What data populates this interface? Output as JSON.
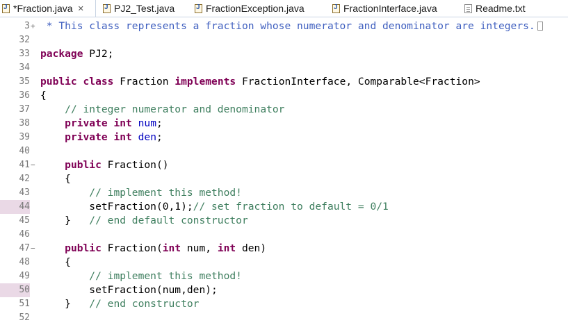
{
  "tabs": [
    {
      "label": "*Fraction.java",
      "icon": "java-file-icon",
      "active": true,
      "close": "✕"
    },
    {
      "label": "PJ2_Test.java",
      "icon": "java-file-icon"
    },
    {
      "label": "FractionException.java",
      "icon": "java-file-icon"
    },
    {
      "label": "FractionInterface.java",
      "icon": "java-file-icon"
    },
    {
      "label": "Readme.txt",
      "icon": "text-file-icon"
    }
  ],
  "editor": {
    "highlighted_lines": [
      "44",
      "50"
    ],
    "lines": [
      {
        "n": "3",
        "fold": "+",
        "t": [
          {
            "s": " * This class represents a fraction whose numerator and denominator are integers.",
            "c": "jd"
          }
        ],
        "collapsed": true
      },
      {
        "n": "32",
        "t": []
      },
      {
        "n": "33",
        "t": [
          {
            "s": "package",
            "c": "kw"
          },
          {
            "s": " PJ2;"
          }
        ]
      },
      {
        "n": "34",
        "t": []
      },
      {
        "n": "35",
        "t": [
          {
            "s": "public",
            "c": "kw"
          },
          {
            "s": " "
          },
          {
            "s": "class",
            "c": "kw"
          },
          {
            "s": " Fraction "
          },
          {
            "s": "implements",
            "c": "kw"
          },
          {
            "s": " FractionInterface, Comparable<Fraction>"
          }
        ]
      },
      {
        "n": "36",
        "t": [
          {
            "s": "{"
          }
        ]
      },
      {
        "n": "37",
        "t": [
          {
            "s": "    "
          },
          {
            "s": "// integer numerator and denominator",
            "c": "cm"
          }
        ]
      },
      {
        "n": "38",
        "t": [
          {
            "s": "    "
          },
          {
            "s": "private",
            "c": "kw"
          },
          {
            "s": " "
          },
          {
            "s": "int",
            "c": "kw"
          },
          {
            "s": " "
          },
          {
            "s": "num",
            "c": "fd"
          },
          {
            "s": ";"
          }
        ]
      },
      {
        "n": "39",
        "t": [
          {
            "s": "    "
          },
          {
            "s": "private",
            "c": "kw"
          },
          {
            "s": " "
          },
          {
            "s": "int",
            "c": "kw"
          },
          {
            "s": " "
          },
          {
            "s": "den",
            "c": "fd"
          },
          {
            "s": ";"
          }
        ]
      },
      {
        "n": "40",
        "t": []
      },
      {
        "n": "41",
        "fold": "−",
        "t": [
          {
            "s": "    "
          },
          {
            "s": "public",
            "c": "kw"
          },
          {
            "s": " Fraction()"
          }
        ]
      },
      {
        "n": "42",
        "t": [
          {
            "s": "    {"
          }
        ]
      },
      {
        "n": "43",
        "t": [
          {
            "s": "        "
          },
          {
            "s": "// implement this method!",
            "c": "cm"
          }
        ]
      },
      {
        "n": "44",
        "hl": true,
        "t": [
          {
            "s": "        setFraction(0,1);"
          },
          {
            "s": "// set fraction to default = 0/1",
            "c": "cm"
          }
        ]
      },
      {
        "n": "45",
        "t": [
          {
            "s": "    }   "
          },
          {
            "s": "// end default constructor",
            "c": "cm"
          }
        ]
      },
      {
        "n": "46",
        "t": []
      },
      {
        "n": "47",
        "fold": "−",
        "t": [
          {
            "s": "    "
          },
          {
            "s": "public",
            "c": "kw"
          },
          {
            "s": " Fraction("
          },
          {
            "s": "int",
            "c": "kw"
          },
          {
            "s": " num, "
          },
          {
            "s": "int",
            "c": "kw"
          },
          {
            "s": " den)"
          }
        ]
      },
      {
        "n": "48",
        "t": [
          {
            "s": "    {"
          }
        ]
      },
      {
        "n": "49",
        "t": [
          {
            "s": "        "
          },
          {
            "s": "// implement this method!",
            "c": "cm"
          }
        ]
      },
      {
        "n": "50",
        "hl": true,
        "t": [
          {
            "s": "        setFraction(num,den);"
          }
        ]
      },
      {
        "n": "51",
        "t": [
          {
            "s": "    }   "
          },
          {
            "s": "// end constructor",
            "c": "cm"
          }
        ]
      },
      {
        "n": "52",
        "t": []
      }
    ]
  }
}
